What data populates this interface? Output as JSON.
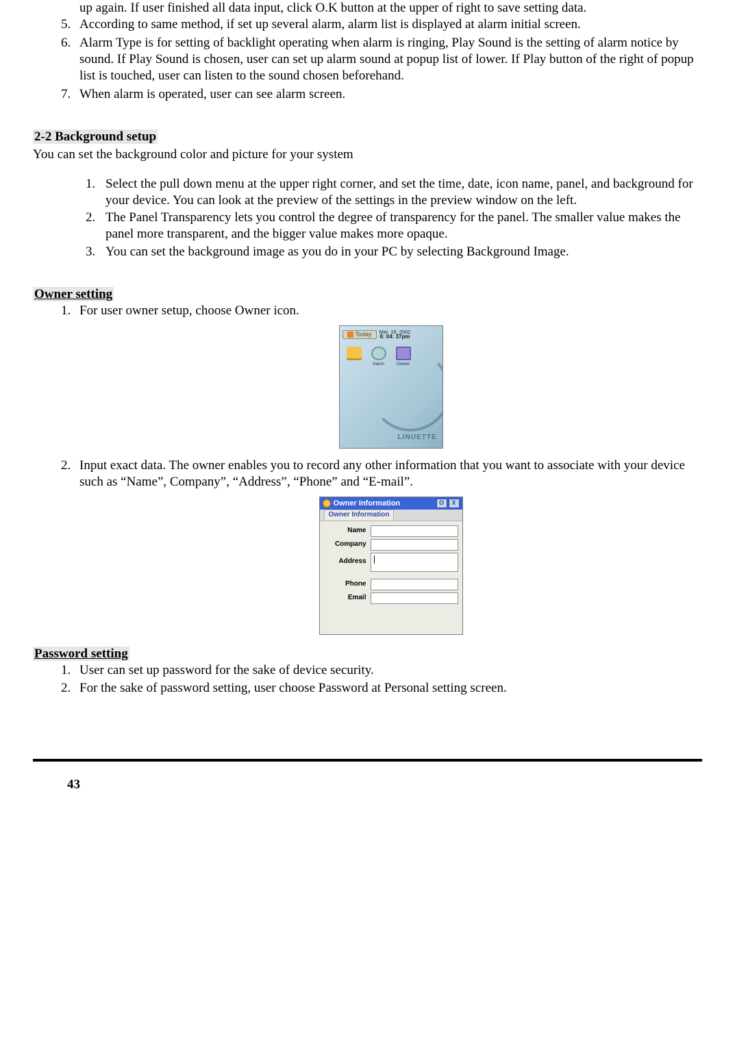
{
  "topList": {
    "start": 5,
    "items": [
      "up again. If user finished all data input, click O.K button at the upper of right to save setting data.",
      "According to same method, if set up several alarm, alarm list is displayed at alarm initial screen.",
      "Alarm Type is for setting of backlight operating when alarm is ringing,  Play Sound is the setting of alarm notice by sound. If Play Sound is chosen, user can set up alarm sound at popup list of lower. If  Play button of the right of popup list is touched, user can listen to the sound chosen beforehand.",
      "When alarm is operated, user can see alarm screen."
    ],
    "fragmentIndex": 0
  },
  "bgSetup": {
    "title": "2-2 Background setup",
    "intro": "You can set the background color and picture for your system",
    "items": [
      "Select the pull down menu at the upper right corner, and set the time, date, icon name, panel, and background for your device. You can look at the preview of the settings in the preview window on the left.",
      "The Panel Transparency lets you control the degree of transparency for the panel. The smaller value makes the panel more transparent, and the bigger value makes more opaque.",
      "You can set the background image as you do in your PC by selecting Background Image."
    ]
  },
  "owner": {
    "title": "Owner setting",
    "item1": "For user owner setup, choose Owner icon.",
    "item2": "Input exact data. The owner enables you to record any other information that you want to associate with your device such as “Name”, Company”, “Address”, “Phone” and “E-mail”."
  },
  "pwd": {
    "title": "Password setting",
    "items": [
      "User can set up password for the sake of device security.",
      "For the sake of  password setting, user choose Password at Personal setting screen."
    ]
  },
  "pda1": {
    "today": "Today",
    "date": "Mar. 19, 2002",
    "time": "6: 04: 37pm",
    "icons": [
      "",
      "Alarm",
      "Owner"
    ],
    "brand": "LINUETTE"
  },
  "pda2": {
    "winTitle": "Owner Information",
    "tab": "Owner Information",
    "labels": {
      "name": "Name",
      "company": "Company",
      "address": "Address",
      "phone": "Phone",
      "email": "Email"
    }
  },
  "pageNumber": "43"
}
